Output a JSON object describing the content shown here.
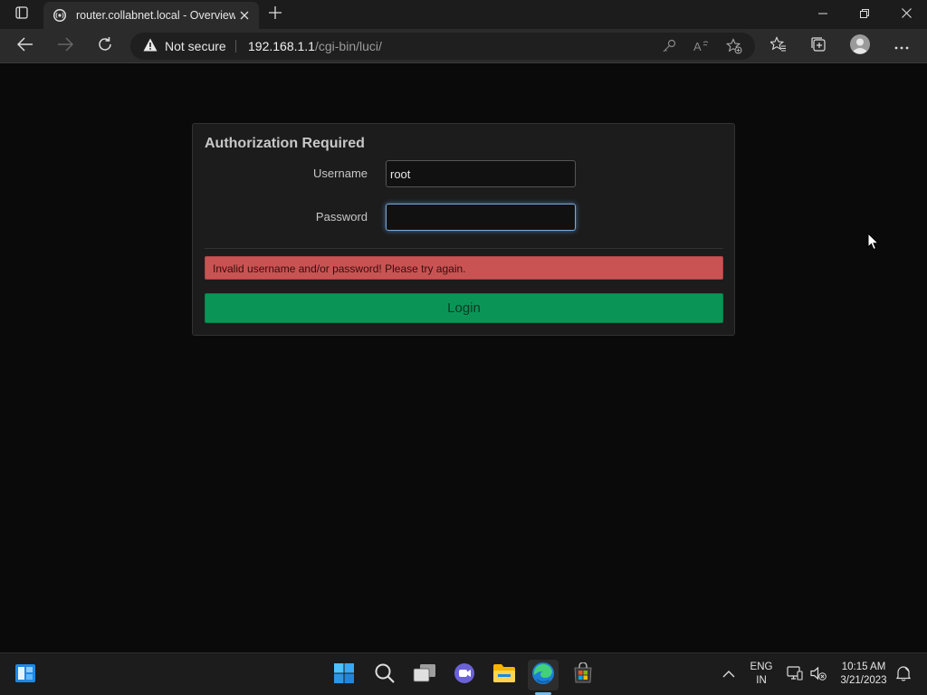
{
  "browser": {
    "tab_title": "router.collabnet.local - Overview",
    "security_label": "Not secure",
    "url_host": "192.168.1.1",
    "url_path": "/cgi-bin/luci/"
  },
  "login": {
    "title": "Authorization Required",
    "username_label": "Username",
    "username_value": "root",
    "password_label": "Password",
    "password_value": "",
    "error_message": "Invalid username and/or password! Please try again.",
    "login_button": "Login"
  },
  "taskbar": {
    "language_line1": "ENG",
    "language_line2": "IN",
    "time": "10:15 AM",
    "date": "3/21/2023"
  },
  "colors": {
    "error_bg": "#c95353",
    "login_bg": "#0a9557",
    "page_bg": "#0a0a0a",
    "card_bg": "#1c1c1c"
  }
}
